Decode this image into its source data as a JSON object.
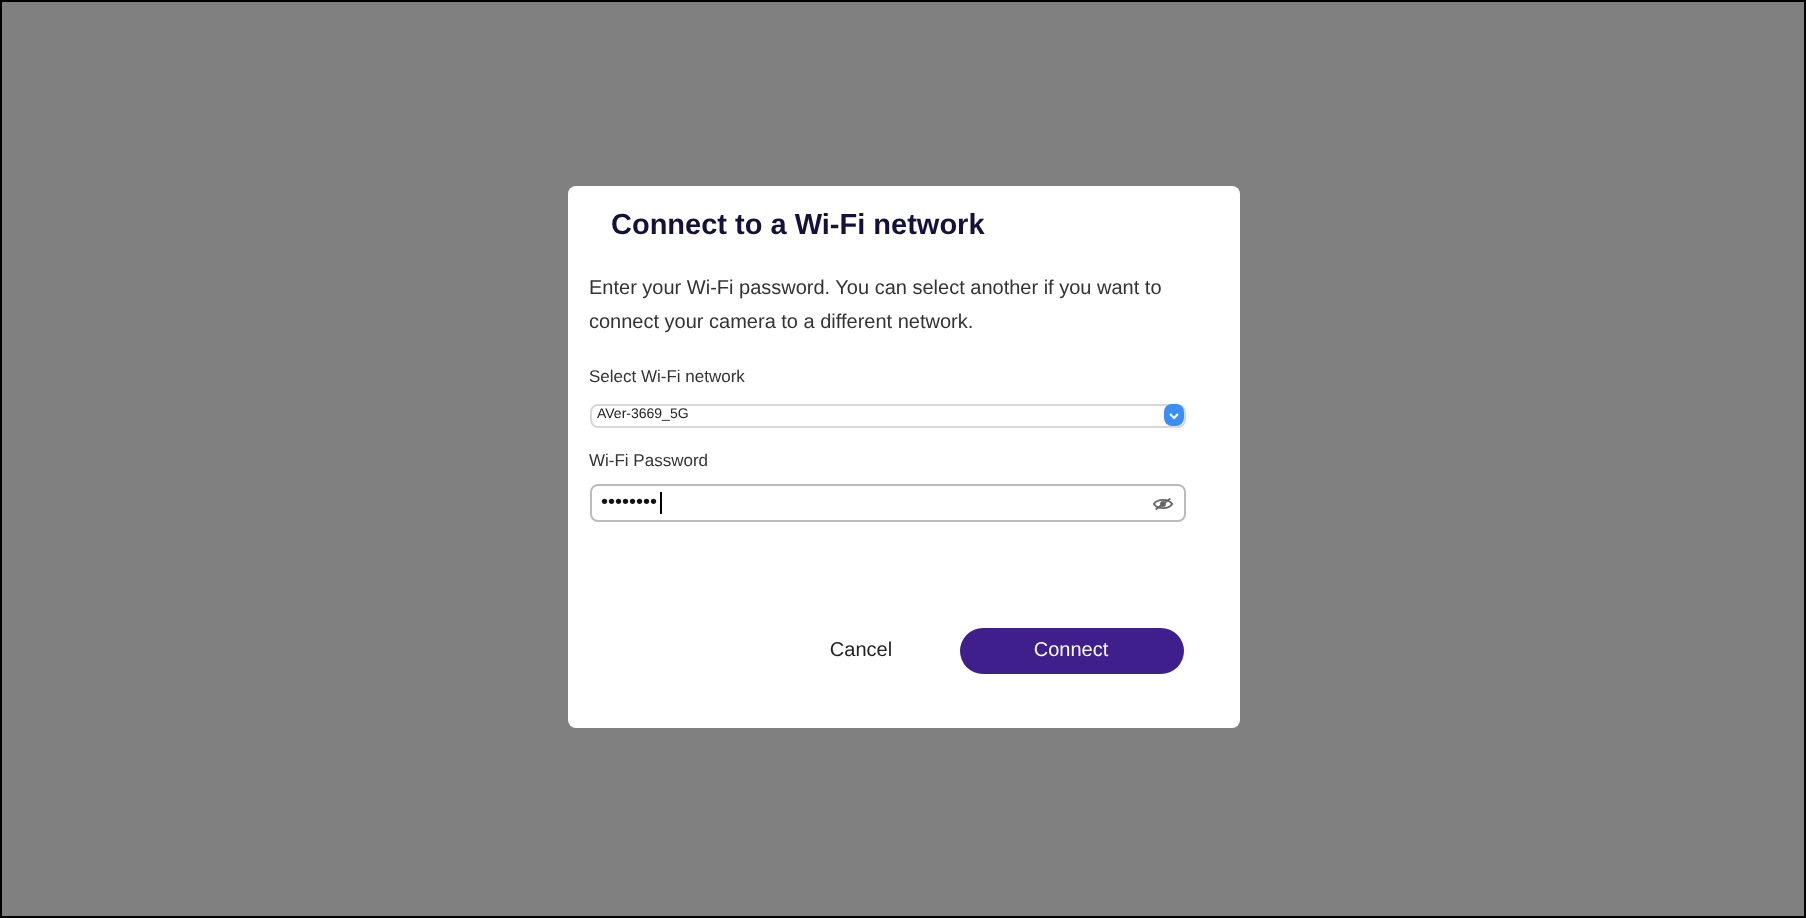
{
  "dialog": {
    "title": "Connect to a Wi-Fi network",
    "description": "Enter your Wi-Fi password. You can select another if you want to connect your camera to a different network.",
    "network": {
      "label": "Select Wi-Fi network",
      "value": "AVer-3669_5G"
    },
    "password": {
      "label": "Wi-Fi Password",
      "value": "••••••••",
      "focused": true
    },
    "buttons": [
      {
        "label": "Cancel",
        "kind": "secondary"
      },
      {
        "label": "Connect",
        "kind": "primary"
      }
    ]
  }
}
